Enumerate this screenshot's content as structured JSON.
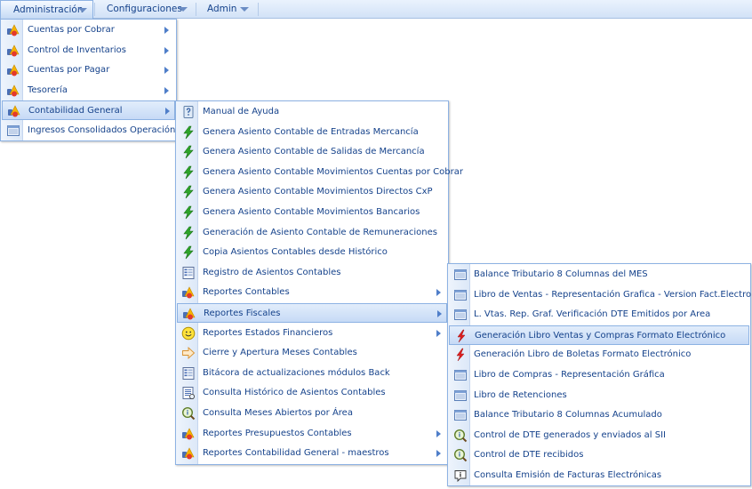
{
  "menubar": {
    "items": [
      {
        "label": "Administración"
      },
      {
        "label": "Configuraciones"
      },
      {
        "label": "Admin"
      }
    ]
  },
  "admin_menu": {
    "items": [
      {
        "label": "Cuentas por Cobrar",
        "icon": "bag-icon",
        "submenu": true
      },
      {
        "label": "Control de Inventarios",
        "icon": "bag-icon",
        "submenu": true
      },
      {
        "label": "Cuentas por Pagar",
        "icon": "bag-icon",
        "submenu": true
      },
      {
        "label": "Tesorería",
        "icon": "bag-icon",
        "submenu": true
      },
      {
        "label": "Contabilidad General",
        "icon": "bag-icon",
        "submenu": true
      },
      {
        "label": "Ingresos Consolidados Operación",
        "icon": "window-icon",
        "submenu": false
      }
    ]
  },
  "contabilidad_menu": {
    "items": [
      {
        "label": "Manual de Ayuda",
        "icon": "help-document-icon",
        "submenu": false
      },
      {
        "label": "Genera Asiento Contable de Entradas Mercancía",
        "icon": "green-bolt-icon",
        "submenu": false
      },
      {
        "label": "Genera Asiento Contable de Salidas de Mercancía",
        "icon": "green-bolt-icon",
        "submenu": false
      },
      {
        "label": "Genera Asiento Contable Movimientos Cuentas por Cobrar",
        "icon": "green-bolt-icon",
        "submenu": false
      },
      {
        "label": "Genera Asiento Contable Movimientos Directos CxP",
        "icon": "green-bolt-icon",
        "submenu": false
      },
      {
        "label": "Genera Asiento Contable Movimientos Bancarios",
        "icon": "green-bolt-icon",
        "submenu": false
      },
      {
        "label": "Generación de Asiento Contable de Remuneraciones",
        "icon": "green-bolt-icon",
        "submenu": false
      },
      {
        "label": "Copia Asientos Contables desde Histórico",
        "icon": "green-bolt-icon",
        "submenu": false
      },
      {
        "label": "Registro de Asientos Contables",
        "icon": "form-icon",
        "submenu": false
      },
      {
        "label": "Reportes Contables",
        "icon": "bag-icon",
        "submenu": true
      },
      {
        "label": "Reportes Fiscales",
        "icon": "bag-icon",
        "submenu": true
      },
      {
        "label": "Reportes Estados Financieros",
        "icon": "smiley-icon",
        "submenu": true
      },
      {
        "label": "Cierre y Apertura Meses Contables",
        "icon": "arrow-right-icon",
        "submenu": false
      },
      {
        "label": "Bitácora de actualizaciones módulos Back",
        "icon": "form-icon",
        "submenu": false
      },
      {
        "label": "Consulta Histórico de Asientos Contables",
        "icon": "list-document-icon",
        "submenu": false
      },
      {
        "label": "Consulta Meses Abiertos por Área",
        "icon": "magnifier-icon",
        "submenu": false
      },
      {
        "label": "Reportes Presupuestos Contables",
        "icon": "bag-icon",
        "submenu": true
      },
      {
        "label": "Reportes Contabilidad General - maestros",
        "icon": "bag-icon",
        "submenu": true
      }
    ]
  },
  "fiscales_menu": {
    "items": [
      {
        "label": "Balance Tributario 8 Columnas del MES",
        "icon": "window-icon"
      },
      {
        "label": "Libro de Ventas - Representación Grafica - Version Fact.Electronica",
        "icon": "window-icon"
      },
      {
        "label": "L. Vtas. Rep. Graf. Verificación DTE Emitidos por Area",
        "icon": "window-icon"
      },
      {
        "label": "Generación Libro Ventas y Compras Formato Electrónico",
        "icon": "red-bolt-icon"
      },
      {
        "label": "Generación Libro de Boletas Formato Electrónico",
        "icon": "red-bolt-icon"
      },
      {
        "label": "Libro de Compras - Representación Gráfica",
        "icon": "window-icon"
      },
      {
        "label": "Libro de Retenciones",
        "icon": "window-icon"
      },
      {
        "label": "Balance Tributario 8 Columnas Acumulado",
        "icon": "window-icon"
      },
      {
        "label": "Control de DTE generados y enviados al SII",
        "icon": "magnifier-icon"
      },
      {
        "label": "Control de DTE recibidos",
        "icon": "magnifier-icon"
      },
      {
        "label": "Consulta Emisión de Facturas Electrónicas",
        "icon": "info-bubble-icon"
      }
    ]
  }
}
